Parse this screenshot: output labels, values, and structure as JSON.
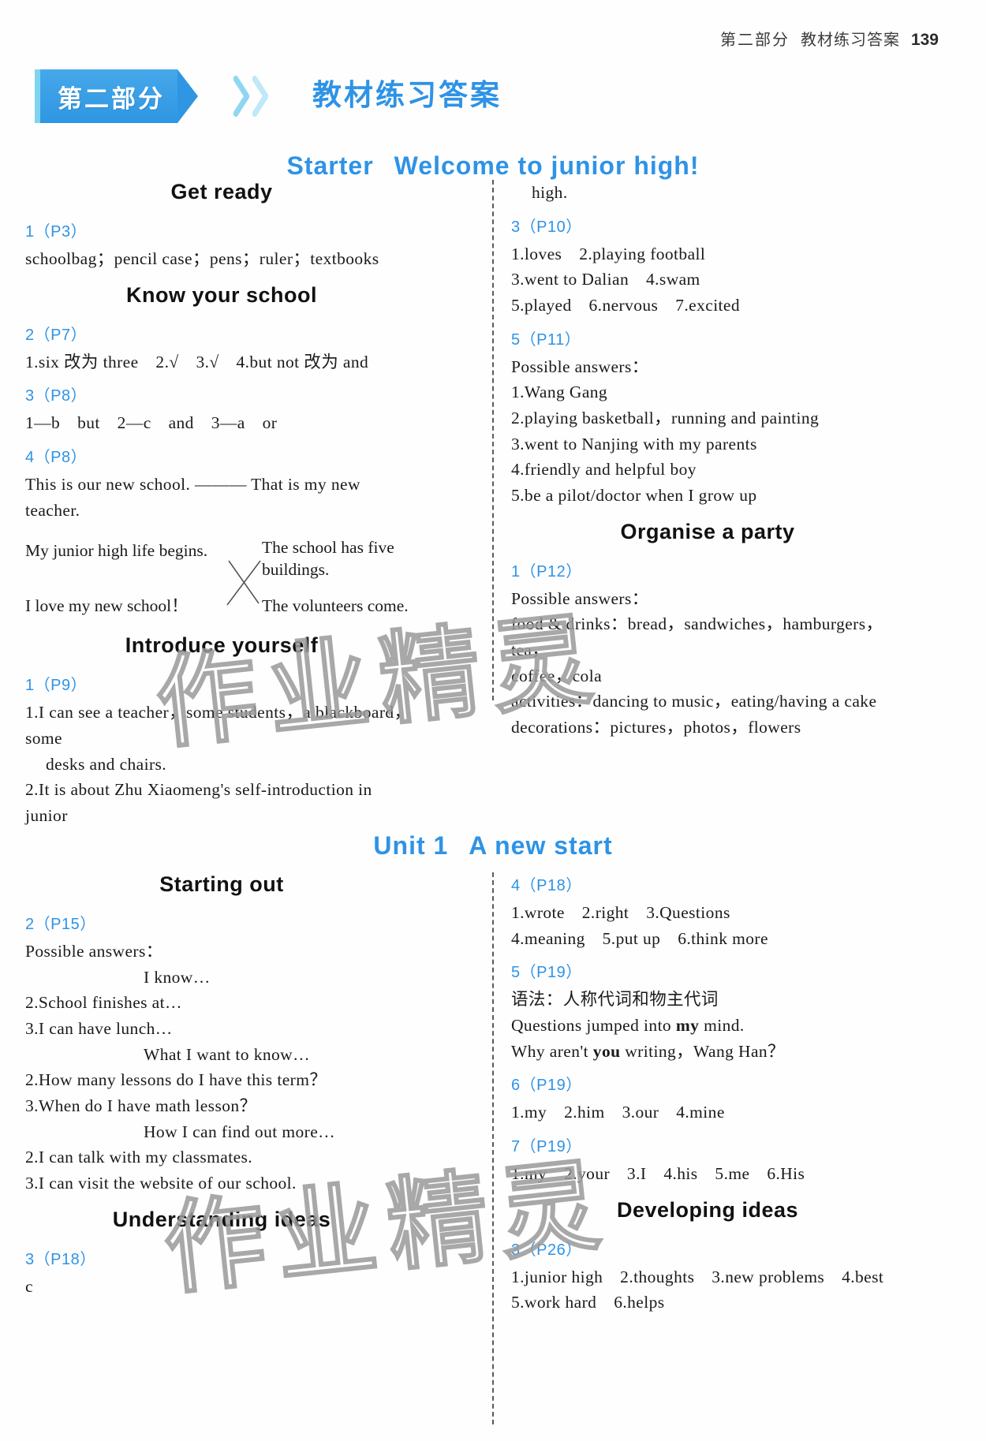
{
  "header": {
    "part": "第二部分",
    "title": "教材练习答案",
    "folio": "139"
  },
  "banner": {
    "ribbon_label": "第二部分",
    "title": "教材练习答案"
  },
  "watermark": {
    "text": "作业精灵"
  },
  "starter": {
    "title_a": "Starter",
    "title_b": "Welcome to junior high!"
  },
  "unit1": {
    "title_a": "Unit 1",
    "title_b": "A new start"
  },
  "sections": {
    "get_ready": "Get ready",
    "know_your_school": "Know your school",
    "introduce_yourself": "Introduce yourself",
    "organise_a_party": "Organise a party",
    "starting_out": "Starting out",
    "understanding_ideas": "Understanding ideas",
    "developing_ideas": "Developing ideas"
  },
  "left_col": {
    "q1_p3": "1（P3）",
    "a1_p3": "schoolbag；pencil case；pens；ruler；textbooks",
    "q2_p7": "2（P7）",
    "a2_p7": "1.six 改为 three　2.√　3.√　4.but not 改为 and",
    "q3_p8": "3（P8）",
    "a3_p8": "1—b　but　2—c　and　3—a　or",
    "q4_p8": "4（P8）",
    "a4_p8_line1": "This is our new school. ——— That is my new teacher.",
    "match_left_1": "My junior high life begins.",
    "match_left_2": "I love my new school！",
    "match_right_1": "The school has five buildings.",
    "match_right_2": "The volunteers come.",
    "q1_p9": "1（P9）",
    "a1_p9_l1": "1.I can see a teacher，some students，a blackboard，some",
    "a1_p9_l2": "desks and chairs.",
    "a1_p9_l3": "2.It is about Zhu Xiaomeng's self-introduction in junior"
  },
  "left_col_unit1": {
    "q2_p15": "2（P15）",
    "possible": "Possible answers：",
    "head_know": "I know…",
    "k2": "2.School finishes at…",
    "k3": "3.I can have lunch…",
    "head_want": "What I want to know…",
    "w2": "2.How many lessons do I have this term？",
    "w3": "3.When do I have math lesson？",
    "head_find": "How I can find out more…",
    "f2": "2.I can talk with my classmates.",
    "f3": "3.I can visit the website of our school.",
    "q3_p18": "3（P18）",
    "a3_p18": "c"
  },
  "right_col": {
    "cont_high": "high.",
    "q3_p10": "3（P10）",
    "a3_p10_l1": "1.loves　2.playing football",
    "a3_p10_l2": "3.went to Dalian　4.swam",
    "a3_p10_l3": "5.played　6.nervous　7.excited",
    "q5_p11": "5（P11）",
    "possible": "Possible answers：",
    "a5_p11_1": "1.Wang Gang",
    "a5_p11_2": "2.playing basketball，running and painting",
    "a5_p11_3": "3.went to Nanjing with my parents",
    "a5_p11_4": "4.friendly and helpful boy",
    "a5_p11_5": "5.be a pilot/doctor when I grow up",
    "q1_p12": "1（P12）",
    "possible2": "Possible answers：",
    "a1_p12_1": "food & drinks：bread，sandwiches，hamburgers，tea，",
    "a1_p12_2": "coffee，cola",
    "a1_p12_3": "activities：dancing to music，eating/having a cake",
    "a1_p12_4": "decorations：pictures，photos，flowers"
  },
  "right_col_unit1": {
    "q4_p18": "4（P18）",
    "a4_p18_l1": "1.wrote　2.right　3.Questions",
    "a4_p18_l2": "4.meaning　5.put up　6.think more",
    "q5_p19": "5（P19）",
    "a5_p19_grammar": "语法：人称代词和物主代词",
    "a5_p19_s1_a": "Questions jumped into ",
    "a5_p19_s1_b": "my",
    "a5_p19_s1_c": " mind.",
    "a5_p19_s2_a": "Why aren't ",
    "a5_p19_s2_b": "you",
    "a5_p19_s2_c": " writing，Wang Han？",
    "q6_p19": "6（P19）",
    "a6_p19": "1.my　2.him　3.our　4.mine",
    "q7_p19": "7（P19）",
    "a7_p19": "1.my　2.your　3.I　4.his　5.me　6.His",
    "q3_p26": "3（P26）",
    "a3_p26_l1": "1.junior high　2.thoughts　3.new problems　4.best",
    "a3_p26_l2": "5.work hard　6.helps"
  },
  "colors": {
    "accent_blue": "#2e93e6",
    "ribbon_blue": "#3aa0e8",
    "ribbon_edge": "#7fd4ef",
    "text": "#1a1a1a"
  }
}
